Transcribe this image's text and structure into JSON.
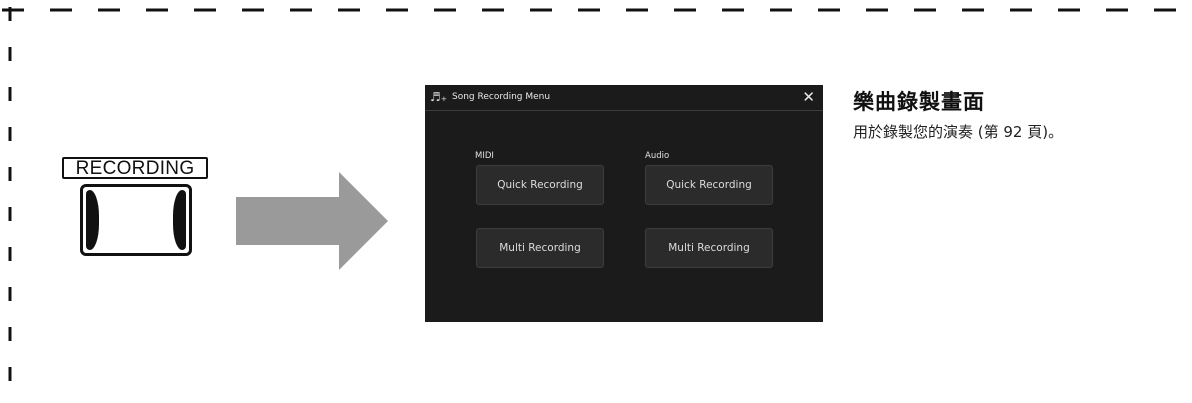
{
  "panel": {
    "button_label": "RECORDING"
  },
  "screen": {
    "title_icon": "♬₊",
    "title": "Song Recording Menu",
    "close_icon": "✕",
    "columns": [
      {
        "label": "MIDI",
        "buttons": [
          "Quick Recording",
          "Multi Recording"
        ]
      },
      {
        "label": "Audio",
        "buttons": [
          "Quick Recording",
          "Multi Recording"
        ]
      }
    ]
  },
  "description": {
    "heading": "樂曲錄製畫面",
    "text": "用於錄製您的演奏 (第 92 頁)。"
  },
  "colors": {
    "screen_bg": "#1b1b1b",
    "button_bg": "#2b2b2b",
    "arrow": "#9a9a9a"
  }
}
